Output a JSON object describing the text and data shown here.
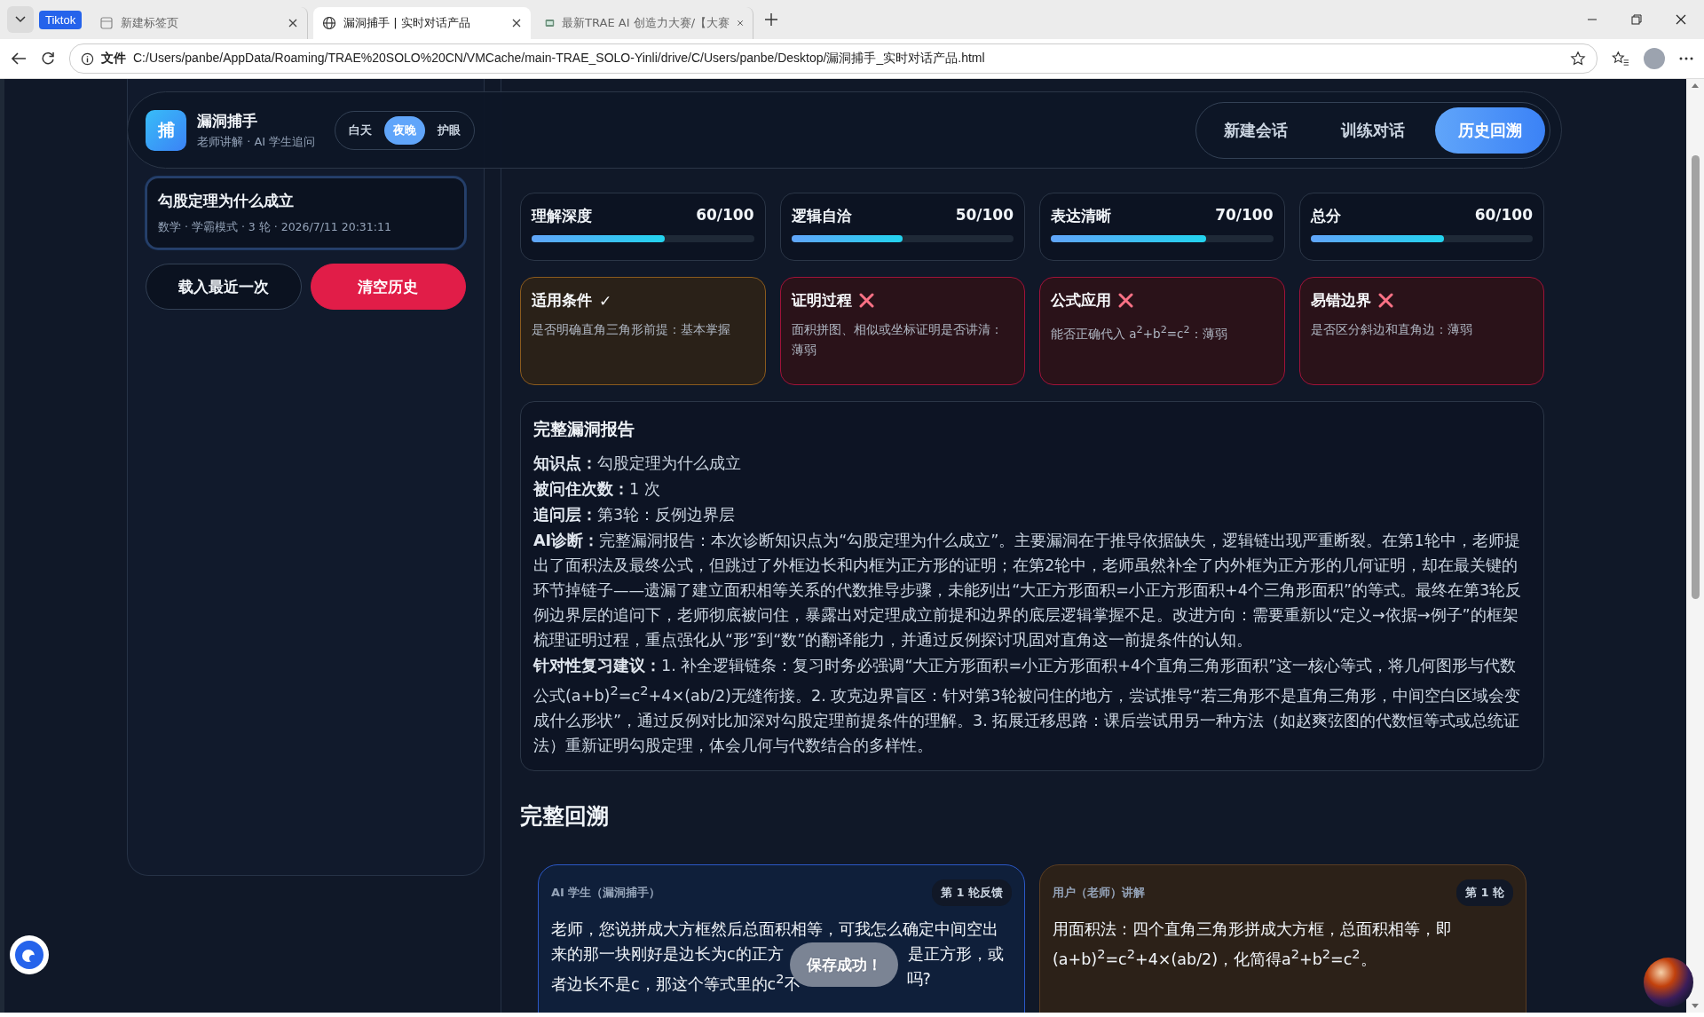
{
  "browser": {
    "tabs": [
      {
        "kind": "group",
        "label": "Tiktok"
      },
      {
        "kind": "page",
        "title": "新建标签页",
        "selected": false
      },
      {
        "kind": "page",
        "title": "漏洞捕手 | 实时对话产品",
        "selected": true
      },
      {
        "kind": "page",
        "title": "最新TRAE AI 创造力大赛/【大赛",
        "selected": false
      }
    ],
    "address": {
      "label": "文件",
      "url": "C:/Users/panbe/AppData/Roaming/TRAE%20SOLO%20CN/VMCache/main-TRAE_SOLO-Yinli/drive/C/Users/panbe/Desktop/漏洞捕手_实时对话产品.html"
    }
  },
  "header": {
    "logo": "捕",
    "title": "漏洞捕手",
    "subtitle": "老师讲解 · AI 学生追问",
    "themes": [
      {
        "label": "白天",
        "selected": false
      },
      {
        "label": "夜晚",
        "selected": true
      },
      {
        "label": "护眼",
        "selected": false
      }
    ],
    "nav": [
      {
        "label": "新建会话",
        "selected": false
      },
      {
        "label": "训练对话",
        "selected": false
      },
      {
        "label": "历史回溯",
        "selected": true
      }
    ]
  },
  "sidebar": {
    "sessions": [
      {
        "title": "勾股定理为什么成立",
        "meta": "数学 · 学霸模式 · 3 轮 · 2026/7/11 20:31:11",
        "selected": true
      }
    ],
    "buttons": [
      {
        "label": "载入最近一次",
        "kind": "secondary"
      },
      {
        "label": "清空历史",
        "kind": "danger"
      }
    ]
  },
  "metrics": [
    {
      "label": "理解深度",
      "score": "60/100",
      "level": 0.6
    },
    {
      "label": "逻辑自洽",
      "score": "50/100",
      "level": 0.5
    },
    {
      "label": "表达清晰",
      "score": "70/100",
      "level": 0.7
    },
    {
      "label": "总分",
      "score": "60/100",
      "level": 0.6
    }
  ],
  "checks": [
    {
      "title": "适用条件",
      "passed": true,
      "symbol": "✓",
      "detail": "是否明确直角三角形前提：基本掌握"
    },
    {
      "title": "证明过程",
      "passed": false,
      "detail": "面积拼图、相似或坐标证明是否讲清：薄弱"
    },
    {
      "title": "公式应用",
      "passed": false,
      "detail": "能否正确代入 a$^{2}$+b$^{2}$=c$^{2}$：薄弱"
    },
    {
      "title": "易错边界",
      "passed": false,
      "detail": "是否区分斜边和直角边：薄弱"
    }
  ],
  "report": {
    "title": "完整漏洞报告",
    "paragraphs": [
      "**知识点：**勾股定理为什么成立",
      "**被问住次数：**1 次",
      "**追问层：**第3轮：反例边界层",
      "**AI诊断：**完整漏洞报告：本次诊断知识点为“勾股定理为什么成立”。主要漏洞在于推导依据缺失，逻辑链出现严重断裂。在第1轮中，老师提出了面积法及最终公式，但跳过了外框边长和内框为正方形的证明；在第2轮中，老师虽然补全了内外框为正方形的几何证明，却在最关键的环节掉链子——遗漏了建立面积相等关系的代数推导步骤，未能列出“大正方形面积=小正方形面积+4个三角形面积”的等式。最终在第3轮反例边界层的追问下，老师彻底被问住，暴露出对定理成立前提和边界的底层逻辑掌握不足。改进方向：需要重新以“定义→依据→例子”的框架梳理证明过程，重点强化从“形”到“数”的翻译能力，并通过反例探讨巩固对直角这一前提条件的认知。",
      "**针对性复习建议：**1. 补全逻辑链条：复习时务必强调“大正方形面积=小正方形面积+4个直角三角形面积”这一核心等式，将几何图形与代数公式(a+b)$^{2}$=c$^{2}$+4×(ab/2)无缝衔接。2. 攻克边界盲区：针对第3轮被问住的地方，尝试推导“若三角形不是直角三角形，中间空白区域会变成什么形状”，通过反例对比加深对勾股定理前提条件的理解。3. 拓展迁移思路：课后尝试用另一种方法（如赵爽弦图的代数恒等式或总统证法）重新证明勾股定理，体会几何与代数结合的多样性。"
    ]
  },
  "review": {
    "title": "完整回溯",
    "turns": [
      {
        "kind": "ai",
        "role": "AI 学生（漏洞捕手）",
        "badge": "第 1 轮反馈",
        "lines": [
          [
            "老师，您说拼成大方框然后总面积相等，可我怎么确定中间空出"
          ],
          [
            "来的那一块刚好是边长为c的正方",
            "是正方形，或"
          ],
          [
            "者边长不是c，那这个等式里的c$^{2}$不",
            "吗?"
          ]
        ]
      },
      {
        "kind": "user",
        "role": "用户（老师）讲解",
        "badge": "第 1 轮",
        "lines": [
          [
            "用面积法：四个直角三角形拼成大方框，总面积相等，即"
          ],
          [
            "(a+b)$^{2}$=c$^{2}$+4×(ab/2)，化简得a$^{2}$+b$^{2}$=c$^{2}$。"
          ]
        ]
      }
    ]
  },
  "toast": "保存成功！"
}
